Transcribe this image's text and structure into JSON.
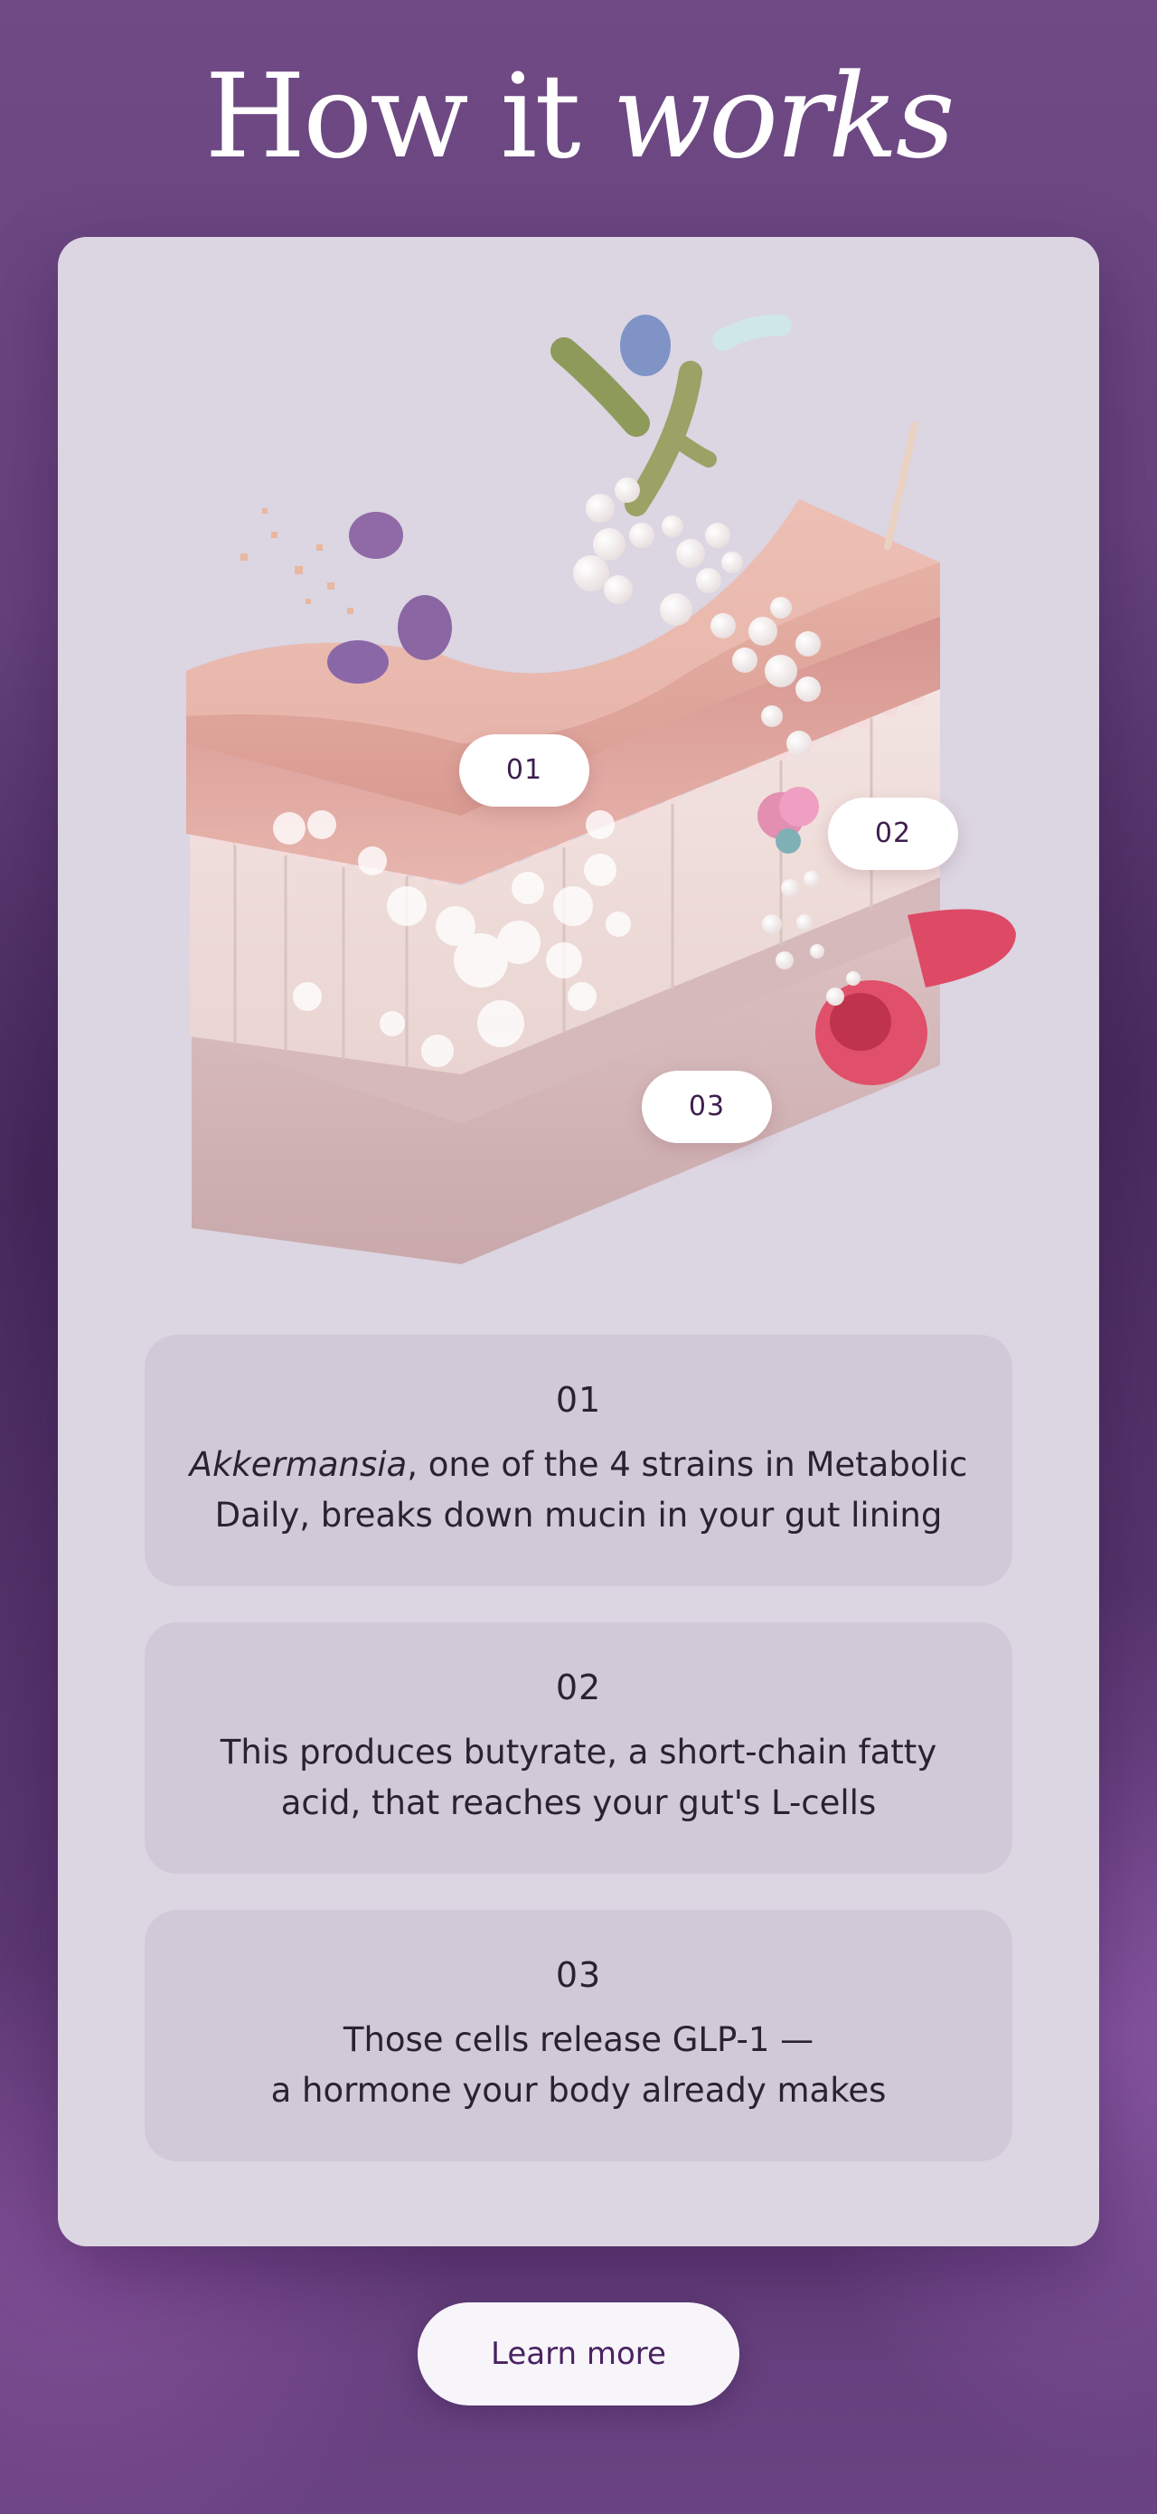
{
  "header": {
    "title_plain": "How it ",
    "title_italic": "works"
  },
  "illustration": {
    "markers": [
      "01",
      "02",
      "03"
    ]
  },
  "steps": [
    {
      "number": "01",
      "text_italic": "Akkermansia",
      "text": ", one of the 4 strains in Metabolic Daily, breaks down mucin in your gut lining"
    },
    {
      "number": "02",
      "text_line1": "This produces butyrate, a short-chain fatty",
      "text_line2": "acid, that reaches your gut's L-cells"
    },
    {
      "number": "03",
      "text_line1": "Those cells release GLP-1 —",
      "text_line2": "a hormone your body already makes"
    }
  ],
  "cta": {
    "label": "Learn more"
  },
  "colors": {
    "background": "#5f3c76",
    "card": "#dcd5e2",
    "step_panel": "#d2c9d8",
    "text": "#2a2230",
    "button_text": "#4a2260"
  }
}
